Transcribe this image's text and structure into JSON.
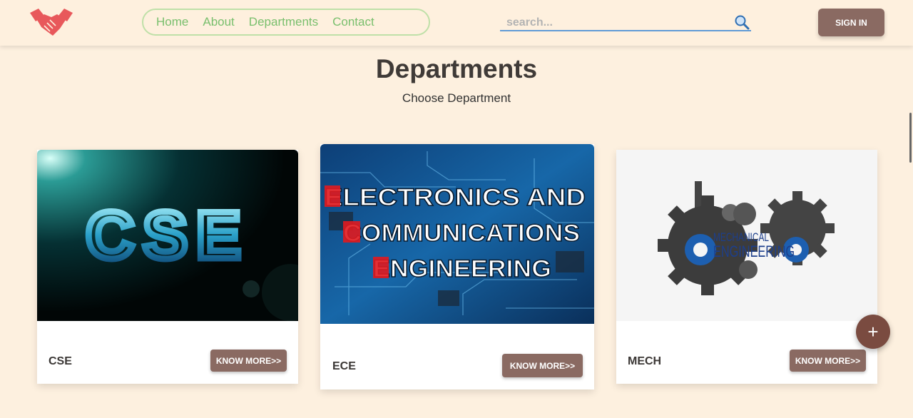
{
  "nav": {
    "links": [
      "Home",
      "About",
      "Departments",
      "Contact"
    ],
    "search_placeholder": "search...",
    "signin_label": "SIGN IN"
  },
  "page": {
    "title": "Departments",
    "subtitle": "Choose Department"
  },
  "cards": [
    {
      "name": "CSE",
      "button": "KNOW MORE>>",
      "image_text": "CSE"
    },
    {
      "name": "ECE",
      "button": "KNOW MORE>>",
      "image_lines": [
        "ELECTRONICS AND",
        "COMMUNICATIONS",
        "ENGINEERING"
      ]
    },
    {
      "name": "MECH",
      "button": "KNOW MORE>>",
      "image_lines": [
        "MECHANICAL",
        "ENGINEERING"
      ]
    }
  ],
  "fab_label": "+",
  "colors": {
    "background": "#fdf0df",
    "nav_link": "#79bf6d",
    "button": "#8a6a62",
    "fab": "#7a4b40",
    "logo": "#e8585b"
  }
}
